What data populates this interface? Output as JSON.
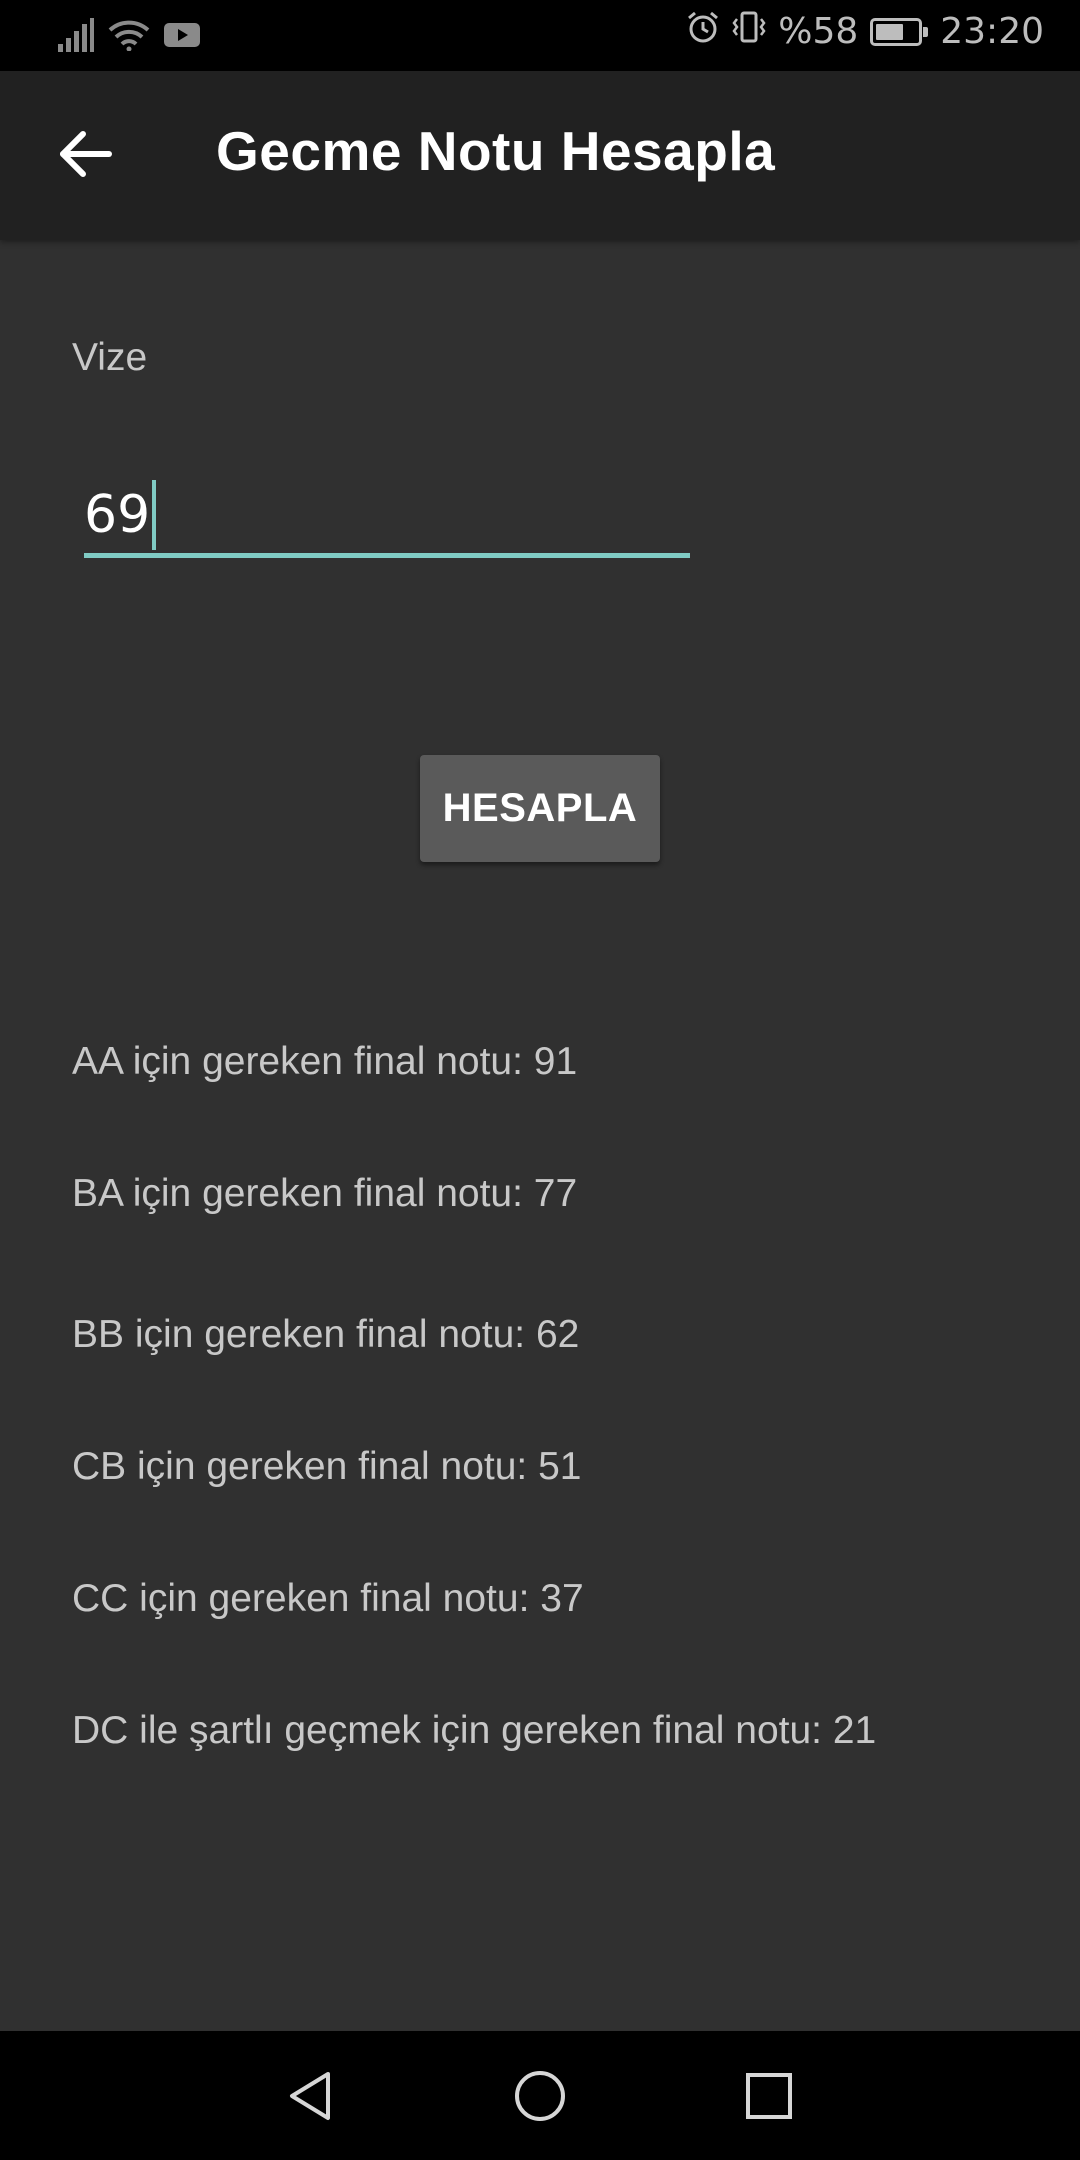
{
  "status_bar": {
    "battery_percent_text": "%58",
    "time": "23:20",
    "battery_level": 0.58,
    "icons": [
      "signal-icon",
      "wifi-icon",
      "youtube-icon",
      "alarm-icon",
      "vibrate-icon",
      "battery-icon"
    ]
  },
  "app_bar": {
    "title": "Gecme Notu Hesapla",
    "back_icon": "arrow-left-icon"
  },
  "form": {
    "vize_label": "Vize",
    "vize_value": "69",
    "accent_color": "#80cbc4"
  },
  "actions": {
    "hesapla_label": "HESAPLA"
  },
  "results": [
    "AA için gereken final notu: 91",
    "BA için gereken final notu: 77",
    "BB için gereken final notu: 62",
    "CB için gereken final notu: 51",
    "CC için gereken final notu: 37",
    "DC ile şartlı geçmek için gereken final notu: 21"
  ],
  "nav_bar": {
    "icons": [
      "nav-back-icon",
      "nav-home-icon",
      "nav-recents-icon"
    ]
  }
}
